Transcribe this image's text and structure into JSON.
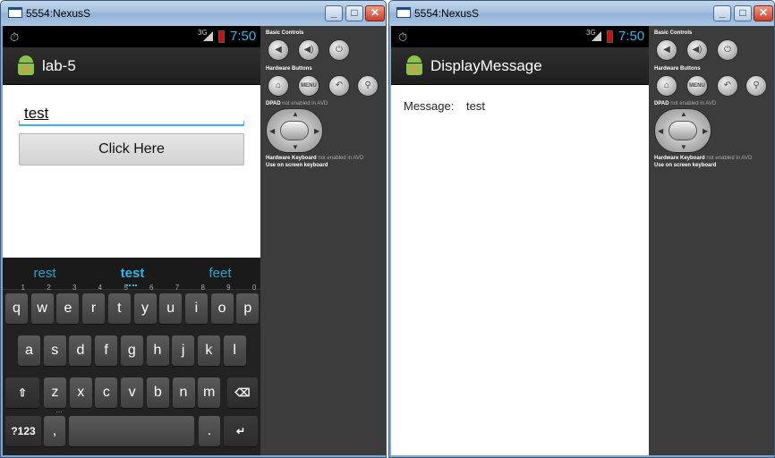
{
  "windows": [
    {
      "title": "5554:NexusS",
      "controls": {
        "minimize": "_",
        "maximize": "□",
        "close": "✕"
      },
      "status_time": "7:50",
      "network": "3G",
      "app_title": "lab-5",
      "edit_text": "test",
      "button_label": "Click Here",
      "suggestions": [
        "rest",
        "test",
        "feet"
      ],
      "keys_row1": [
        "q",
        "w",
        "e",
        "r",
        "t",
        "y",
        "u",
        "i",
        "o",
        "p"
      ],
      "keys_row1_hints": [
        "1",
        "2",
        "3",
        "4",
        "5",
        "6",
        "7",
        "8",
        "9",
        "0"
      ],
      "keys_row2": [
        "a",
        "s",
        "d",
        "f",
        "g",
        "h",
        "j",
        "k",
        "l"
      ],
      "keys_row3": [
        "z",
        "x",
        "c",
        "v",
        "b",
        "n",
        "m"
      ],
      "key_symbols": "?123",
      "key_comma": ",",
      "key_period": ".",
      "key_comma_hint": "…"
    },
    {
      "title": "5554:NexusS",
      "controls": {
        "minimize": "_",
        "maximize": "□",
        "close": "✕"
      },
      "status_time": "7:50",
      "network": "3G",
      "app_title": "DisplayMessage",
      "message_label": "Message:",
      "message_value": "test"
    }
  ],
  "panel": {
    "basic_controls": "Basic Controls",
    "hardware_buttons": "Hardware Buttons",
    "menu_label": "MENU",
    "dpad_label": "DPAD",
    "dpad_note": "not enabled in AVD",
    "hw_keyboard_label": "Hardware Keyboard",
    "hw_keyboard_note": "not enabled in AVD",
    "onscreen_keyboard": "Use on screen keyboard"
  },
  "colors": {
    "holo_blue": "#33b5e5",
    "action_bar": "#2a2a2a",
    "panel": "#3c3c3c",
    "key": "#4a4a4a"
  }
}
